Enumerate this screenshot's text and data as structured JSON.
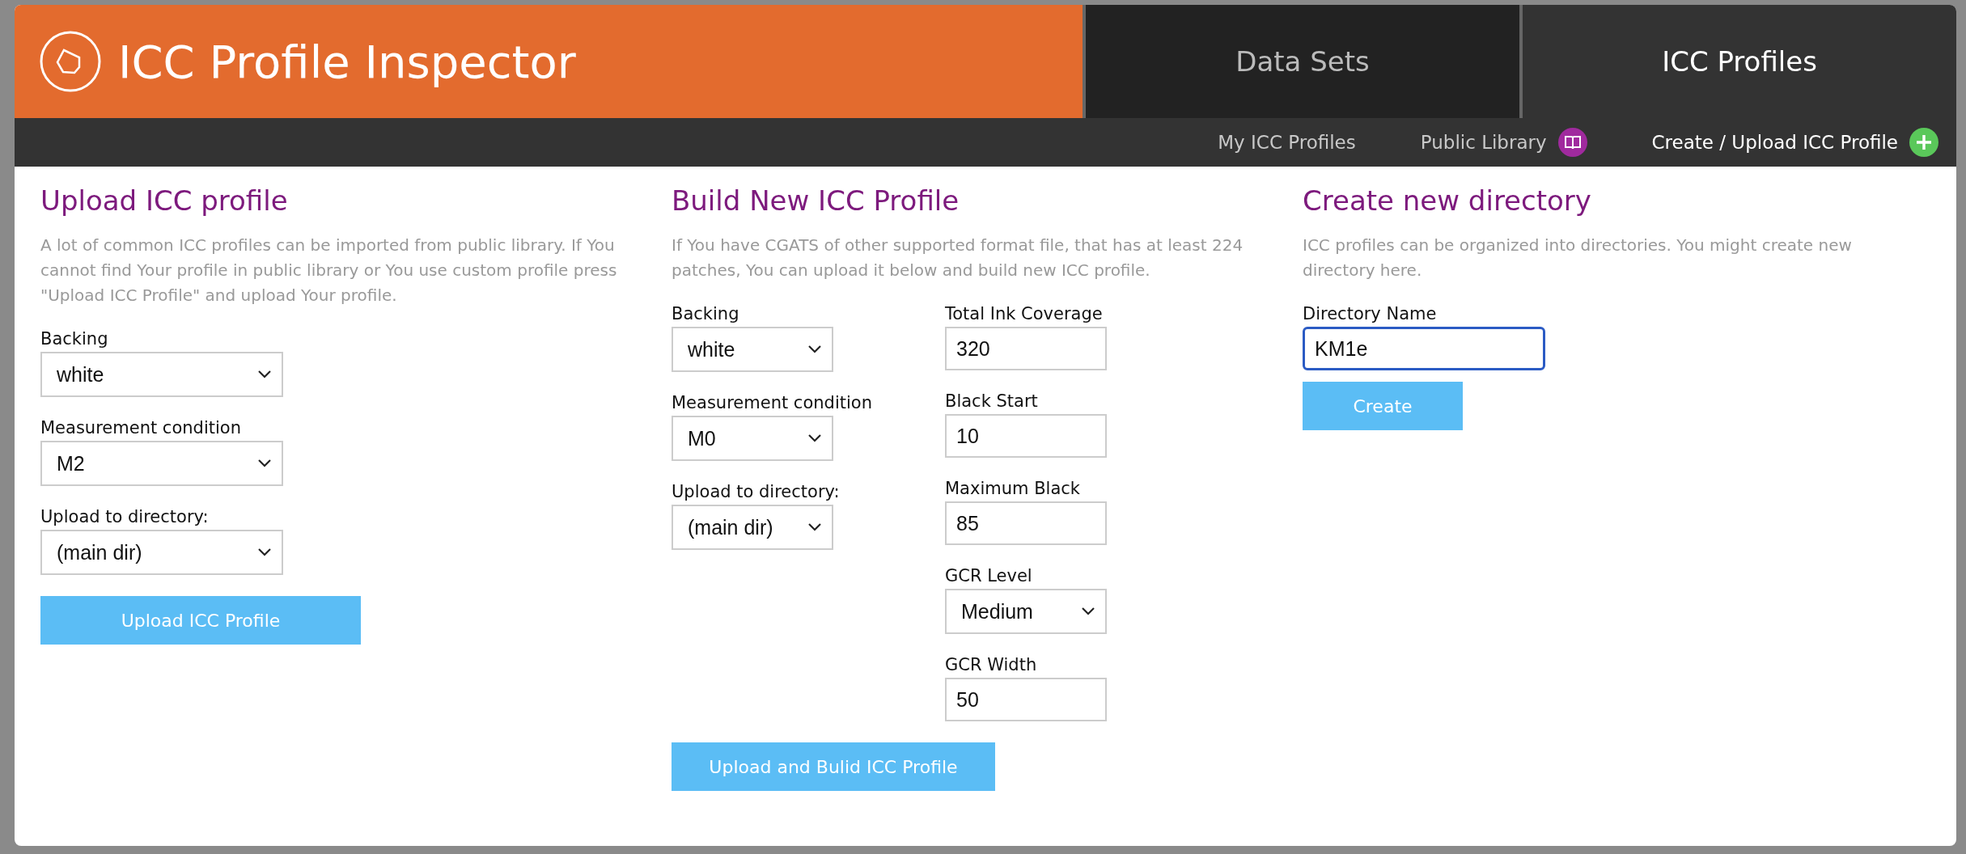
{
  "header": {
    "title": "ICC Profile Inspector",
    "tabs": [
      {
        "label": "Data Sets",
        "selected": false
      },
      {
        "label": "ICC Profiles",
        "selected": true
      }
    ]
  },
  "subnav": [
    {
      "label": "My ICC Profiles",
      "selected": false,
      "kind": "plain"
    },
    {
      "label": "Public Library",
      "selected": false,
      "kind": "library"
    },
    {
      "label": "Create / Upload ICC Profile",
      "selected": true,
      "kind": "create"
    }
  ],
  "sections": [
    {
      "title": "Upload ICC profile",
      "description": "A lot of common ICC profiles can be imported from public library. If You cannot find Your profile in public library or You use custom profile press \"Upload ICC Profile\" and upload Your profile.",
      "columns": [
        [
          {
            "kind": "select",
            "label": "Backing",
            "value": "white"
          },
          {
            "kind": "select",
            "label": "Measurement condition",
            "value": "M2"
          },
          {
            "kind": "select",
            "label": "Upload to directory:",
            "value": "(main dir)"
          }
        ]
      ],
      "button": "Upload ICC Profile"
    },
    {
      "title": "Build New ICC Profile",
      "description": "If You have CGATS of other supported format file, that has at least 224 patches, You can upload it below and build new ICC profile.",
      "columns": [
        [
          {
            "kind": "select",
            "label": "Backing",
            "value": "white"
          },
          {
            "kind": "select",
            "label": "Measurement condition",
            "value": "M0"
          },
          {
            "kind": "select",
            "label": "Upload to directory:",
            "value": "(main dir)"
          }
        ],
        [
          {
            "kind": "text",
            "label": "Total Ink Coverage",
            "value": "320",
            "focused": false
          },
          {
            "kind": "text",
            "label": "Black Start",
            "value": "10",
            "focused": false
          },
          {
            "kind": "text",
            "label": "Maximum Black",
            "value": "85",
            "focused": false
          },
          {
            "kind": "select",
            "label": "GCR Level",
            "value": "Medium"
          },
          {
            "kind": "text",
            "label": "GCR Width",
            "value": "50",
            "focused": false
          }
        ]
      ],
      "button": "Upload and Bulid ICC Profile"
    },
    {
      "title": "Create new directory",
      "description": "ICC profiles can be organized into directories. You might create new directory here.",
      "columns": [
        [
          {
            "kind": "text",
            "label": "Directory Name",
            "value": "KM1e",
            "focused": true
          }
        ]
      ],
      "button": "Create"
    }
  ]
}
